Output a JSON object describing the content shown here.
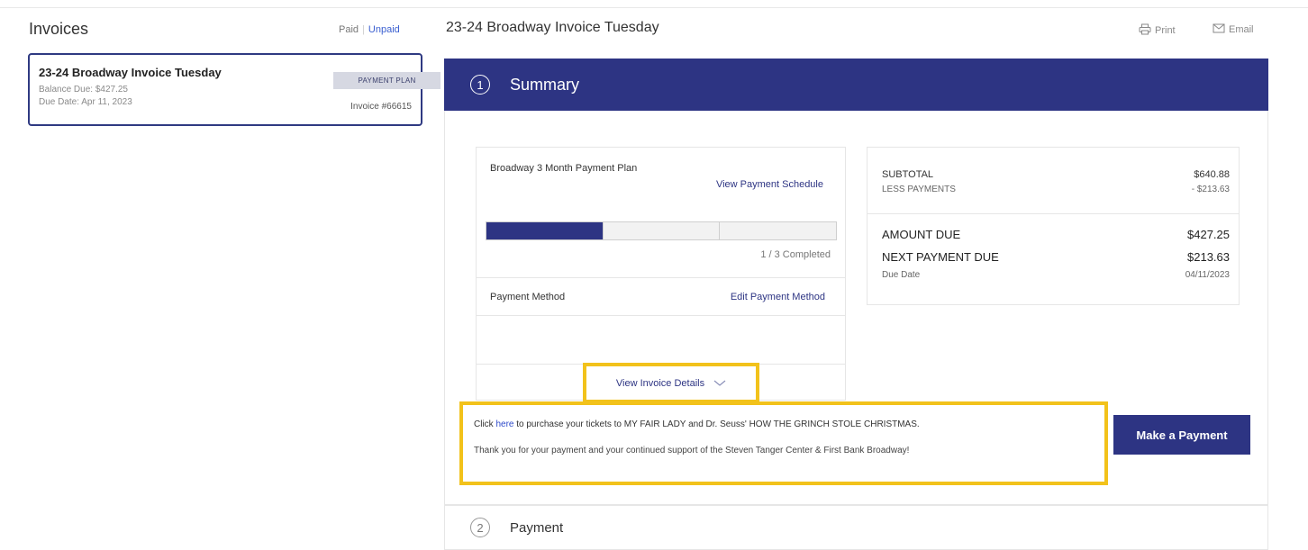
{
  "left": {
    "title": "Invoices",
    "filters": [
      "Paid",
      "Unpaid"
    ],
    "invoice": {
      "name": "23-24 Broadway Invoice Tuesday",
      "balance_due": "Balance Due: $427.25",
      "due_date": "Due Date: Apr 11, 2023",
      "badge": "PAYMENT PLAN",
      "number": "Invoice #66615"
    }
  },
  "detail": {
    "title": "23-24 Broadway Invoice Tuesday",
    "print_label": "Print",
    "email_label": "Email"
  },
  "summary": {
    "step": "1",
    "label": "Summary",
    "plan_name": "Broadway 3 Month Payment Plan",
    "view_schedule": "View Payment Schedule",
    "progress": {
      "completed": 1,
      "total": 3,
      "text": "1 / 3 Completed"
    },
    "payment_method_label": "Payment Method",
    "edit_payment_method": "Edit Payment Method",
    "view_invoice_details": "View Invoice Details"
  },
  "totals": {
    "subtotal_label": "SUBTOTAL",
    "subtotal_value": "$640.88",
    "less_payments_label": "LESS PAYMENTS",
    "less_payments_value": "- $213.63",
    "amount_due_label": "AMOUNT DUE",
    "amount_due_value": "$427.25",
    "next_payment_label": "NEXT PAYMENT DUE",
    "next_payment_value": "$213.63",
    "due_date_label": "Due Date",
    "due_date_value": "04/11/2023"
  },
  "message": {
    "line1_prefix": "Click",
    "line1_link": "here",
    "line1_suffix": "to purchase your tickets to MY FAIR LADY and Dr. Seuss' HOW THE GRINCH STOLE CHRISTMAS.",
    "line2": "Thank you for your payment and your continued support of the Steven Tanger Center & First Bank Broadway!"
  },
  "make_payment_label": "Make a Payment",
  "payment_step": {
    "step": "2",
    "label": "Payment"
  },
  "colors": {
    "brand_navy": "#2d3483",
    "highlight_yellow": "#f2c21b",
    "badge_bg": "#d6d8e2"
  }
}
